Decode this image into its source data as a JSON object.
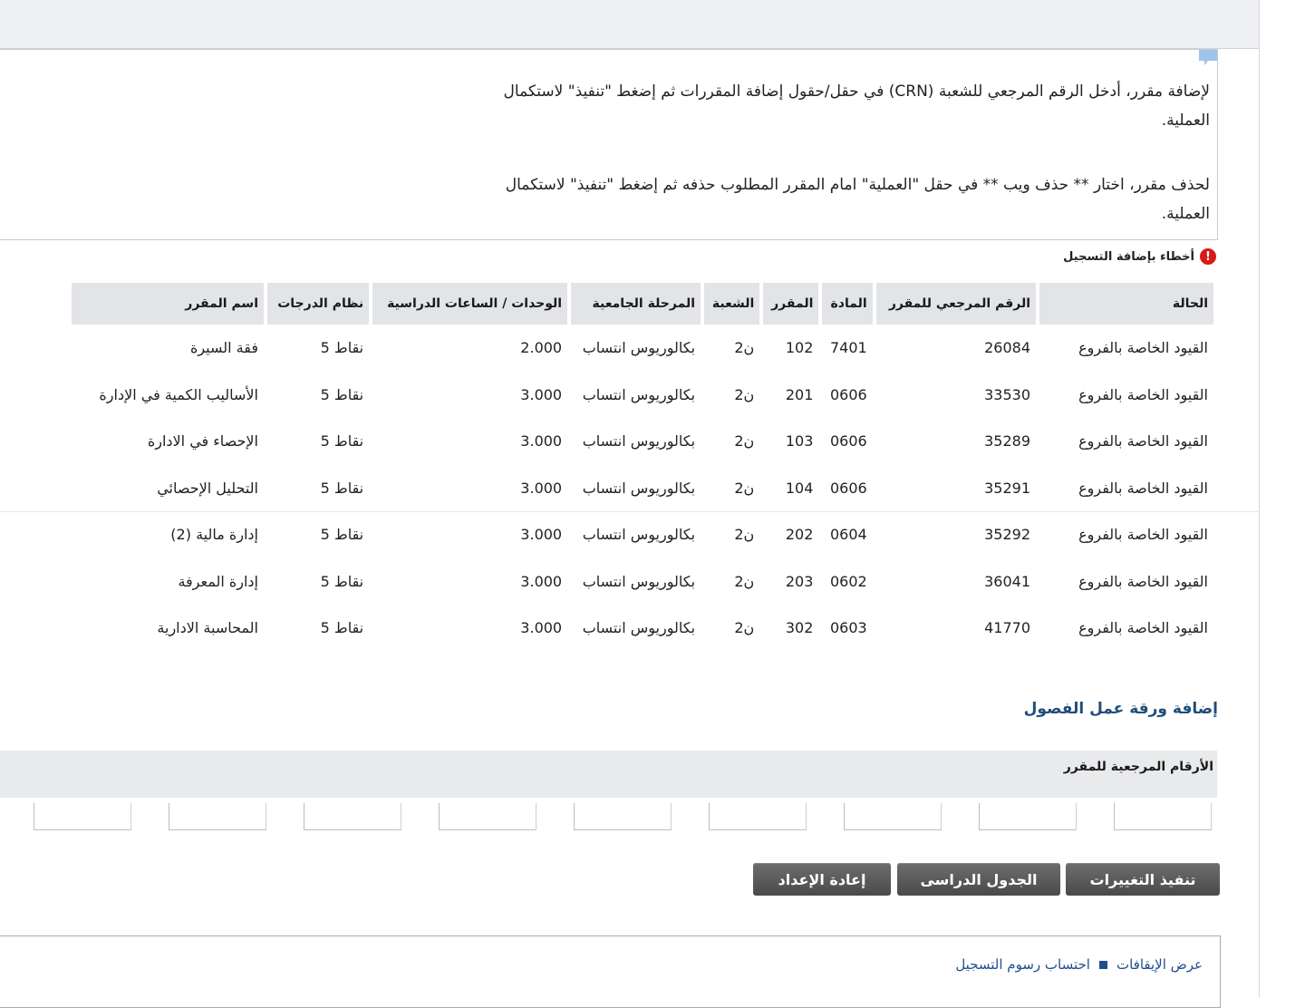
{
  "instructions": {
    "add_text": "لإضافة مقرر، أدخل الرقم المرجعي للشعبة (CRN) في حقل/حقول إضافة المقررات ثم إضغط \"تنفيذ\" لاستكمال العملية.",
    "drop_text": "لحذف مقرر، اختار ** حذف ويب ** في حقل \"العملية\" امام المقرر المطلوب حذفه ثم إضغط \"تنفيذ\" لاستكمال العملية."
  },
  "errors": {
    "title": "أخطاء بإضافة التسجيل",
    "columns": [
      "الحالة",
      "الرقم المرجعي للمقرر",
      "المادة",
      "المقرر",
      "الشعبة",
      "المرحلة الجامعية",
      "الوحدات / الساعات الدراسية",
      "نظام الدرجات",
      "اسم المقرر"
    ],
    "rows": [
      [
        "القيود الخاصة بالفروع",
        "26084",
        "7401",
        "102",
        "ن2",
        "بكالوريوس انتساب",
        "2.000",
        "نقاط 5",
        "فقة السيرة"
      ],
      [
        "القيود الخاصة بالفروع",
        "33530",
        "0606",
        "201",
        "ن2",
        "بكالوريوس انتساب",
        "3.000",
        "نقاط 5",
        "الأساليب الكمية في الإدارة"
      ],
      [
        "القيود الخاصة بالفروع",
        "35289",
        "0606",
        "103",
        "ن2",
        "بكالوريوس انتساب",
        "3.000",
        "نقاط 5",
        "الإحصاء في الادارة"
      ],
      [
        "القيود الخاصة بالفروع",
        "35291",
        "0606",
        "104",
        "ن2",
        "بكالوريوس انتساب",
        "3.000",
        "نقاط 5",
        "التحليل الإحصائي"
      ],
      [
        "القيود الخاصة بالفروع",
        "35292",
        "0604",
        "202",
        "ن2",
        "بكالوريوس انتساب",
        "3.000",
        "نقاط 5",
        "إدارة مالية (2)"
      ],
      [
        "القيود الخاصة بالفروع",
        "36041",
        "0602",
        "203",
        "ن2",
        "بكالوريوس انتساب",
        "3.000",
        "نقاط 5",
        "إدارة المعرفة"
      ],
      [
        "القيود الخاصة بالفروع",
        "41770",
        "0603",
        "302",
        "ن2",
        "بكالوريوس انتساب",
        "3.000",
        "نقاط 5",
        "المحاسبة الادارية"
      ]
    ]
  },
  "worksheet": {
    "title": "إضافة ورقة عمل الفصول",
    "crn_label": "الأرقام المرجعية للمقرر",
    "crn_inputs": [
      "",
      "",
      "",
      "",
      "",
      "",
      "",
      "",
      ""
    ]
  },
  "buttons": {
    "submit": "تنفيذ التغييرات",
    "schedule": "الجدول الدراسى",
    "reset": "إعادة الإعداد"
  },
  "footer": {
    "link_holds": "عرض الإيقافات",
    "link_fees": "احتساب رسوم التسجيل"
  },
  "colors": {
    "error_red": "#d71a1a",
    "header_gray": "#e2e4e7",
    "button_gray": "#4a4a4a",
    "link_blue": "#1f4e8f",
    "title_blue": "#1f4e79"
  }
}
